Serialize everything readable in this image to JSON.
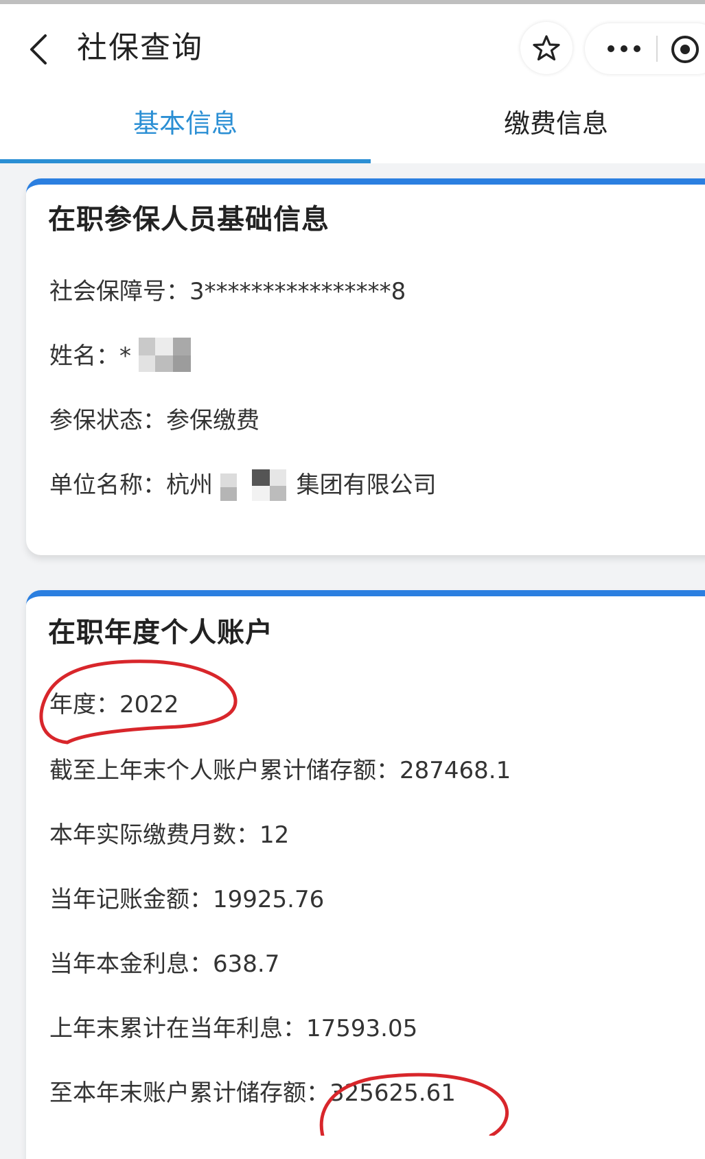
{
  "nav": {
    "title": "社保查询",
    "back_icon": "chevron-left-icon",
    "star_icon": "star-icon",
    "more_icon": "more-dots-icon",
    "close_icon": "close-miniprogram-icon"
  },
  "tabs": [
    {
      "label": "基本信息",
      "active": true
    },
    {
      "label": "缴费信息",
      "active": false
    }
  ],
  "colors": {
    "accent": "#2b8fd4",
    "card_border": "#2b7fe0",
    "annotation_red": "#d8262b"
  },
  "basic_card": {
    "title": "在职参保人员基础信息",
    "rows": [
      {
        "label": "社会保障号：",
        "value": "3****************8"
      },
      {
        "label": "姓名：",
        "value": "*"
      },
      {
        "label": "参保状态：",
        "value": "参保缴费"
      },
      {
        "label": "单位名称：",
        "value_prefix": "杭州",
        "value_suffix": "集团有限公司"
      }
    ]
  },
  "account_card": {
    "title": "在职年度个人账户",
    "rows": [
      {
        "label": "年度：",
        "value": "2022"
      },
      {
        "label": "截至上年末个人账户累计储存额：",
        "value": "287468.1"
      },
      {
        "label": "本年实际缴费月数：",
        "value": "12"
      },
      {
        "label": "当年记账金额：",
        "value": "19925.76"
      },
      {
        "label": "当年本金利息：",
        "value": "638.7"
      },
      {
        "label": "上年末累计在当年利息：",
        "value": "17593.05"
      },
      {
        "label": "至本年末账户累计储存额：",
        "value": "325625.61"
      }
    ]
  }
}
